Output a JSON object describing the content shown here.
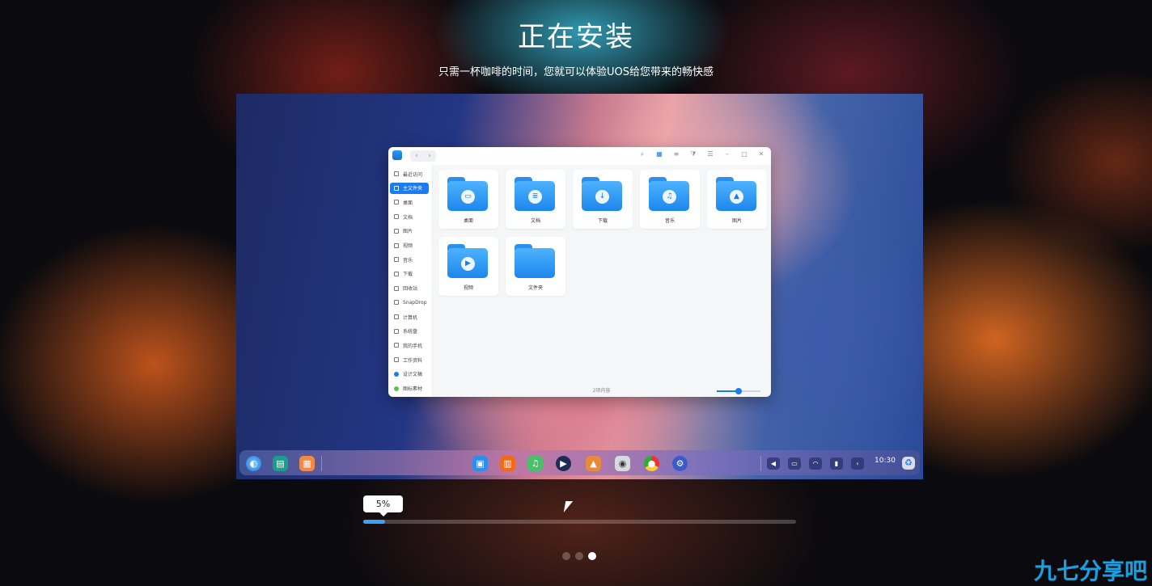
{
  "header": {
    "title": "正在安装",
    "subtitle": "只需一杯咖啡的时间，您就可以体验UOS给您带来的畅快感"
  },
  "file_manager": {
    "sidebar": [
      {
        "label": "最近访问"
      },
      {
        "label": "主文件夹",
        "selected": true
      },
      {
        "label": "桌面"
      },
      {
        "label": "文档"
      },
      {
        "label": "图片"
      },
      {
        "label": "视频"
      },
      {
        "label": "音乐"
      },
      {
        "label": "下载"
      },
      {
        "label": "回收站"
      },
      {
        "label": "SnapDrop"
      },
      {
        "label": "计算机"
      },
      {
        "label": "系统盘"
      },
      {
        "label": "我的手机"
      },
      {
        "label": "工作资料"
      },
      {
        "label": "设计文稿"
      },
      {
        "label": "图标素材"
      }
    ],
    "folders": [
      {
        "label": "桌面",
        "icon": "desktop-icon",
        "glyph": "▭"
      },
      {
        "label": "文档",
        "icon": "document-icon",
        "glyph": "≣"
      },
      {
        "label": "下载",
        "icon": "download-icon",
        "glyph": "↓"
      },
      {
        "label": "音乐",
        "icon": "music-icon",
        "glyph": "♫"
      },
      {
        "label": "图片",
        "icon": "picture-icon",
        "glyph": "▲"
      },
      {
        "label": "视频",
        "icon": "video-icon",
        "glyph": "▶"
      },
      {
        "label": "文件夹",
        "icon": "folder-icon",
        "glyph": ""
      }
    ],
    "status": "2项内容"
  },
  "dock": {
    "clock": "10:30"
  },
  "progress": {
    "label": "5%",
    "value": 5
  },
  "pager": {
    "count": 3,
    "active": 2
  },
  "watermark": "九七分享吧",
  "colors": {
    "accent": "#1a7cf0",
    "progress": "#3aa2f5"
  }
}
